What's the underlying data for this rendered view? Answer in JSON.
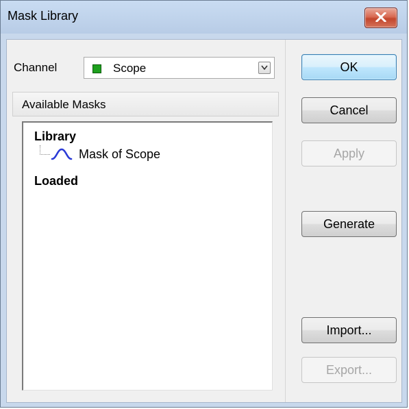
{
  "window": {
    "title": "Mask Library"
  },
  "channel": {
    "label": "Channel",
    "value": "Scope",
    "swatch_color": "#1ea01e"
  },
  "masks": {
    "header": "Available Masks",
    "tree": {
      "library_label": "Library",
      "items": [
        {
          "label": "Mask of Scope",
          "icon": "mask-waveform-icon"
        }
      ],
      "loaded_label": "Loaded"
    }
  },
  "buttons": {
    "ok": "OK",
    "cancel": "Cancel",
    "apply": "Apply",
    "generate": "Generate",
    "import": "Import...",
    "export": "Export..."
  },
  "colors": {
    "close_button": "#c2462d",
    "default_button_border": "#3c7fb1",
    "mask_icon": "#2a3ad6"
  }
}
